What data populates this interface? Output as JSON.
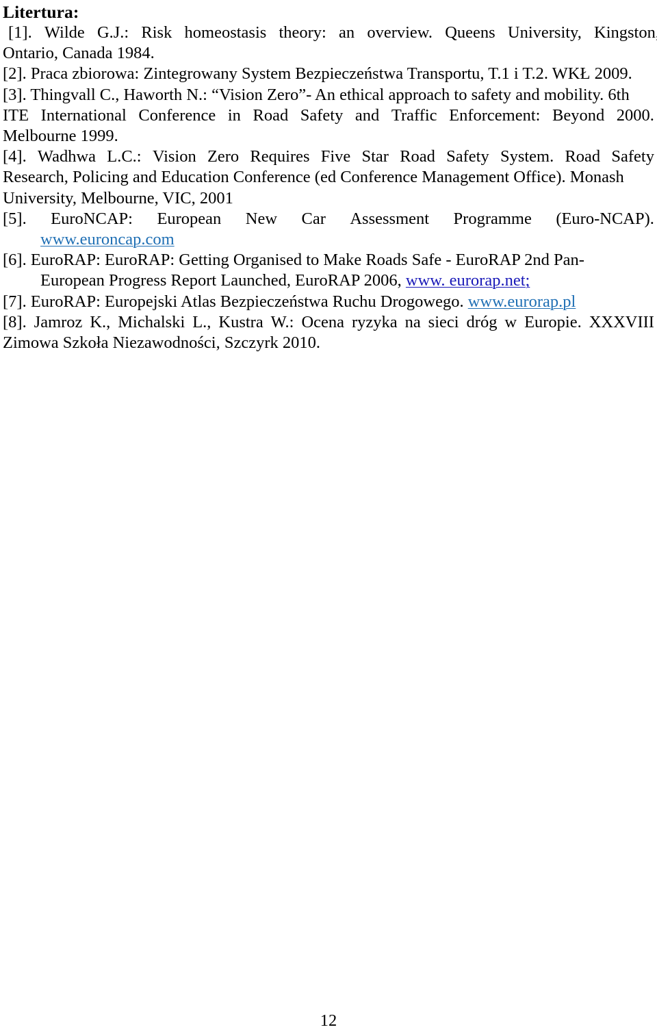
{
  "document": {
    "heading": "Litertura:",
    "page_number": "12",
    "link_color": "#1f6fb4",
    "link_color_alt": "#1818b8",
    "text_color": "#000000",
    "background_color": "#ffffff"
  },
  "references": [
    {
      "marker": "[1].",
      "lines": [
        {
          "segments": [
            {
              "text": "[1]."
            },
            {
              "text": "Wilde"
            },
            {
              "text": "G.J.:"
            },
            {
              "text": "Risk"
            },
            {
              "text": "homeostasis"
            },
            {
              "text": "theory:"
            },
            {
              "text": "an"
            },
            {
              "text": "overview."
            },
            {
              "text": "Queens"
            },
            {
              "text": "University,"
            },
            {
              "text": "Kingston,"
            }
          ],
          "justified": true,
          "indent": "first"
        },
        {
          "text": "Ontario, Canada 1984.",
          "justified": false
        }
      ]
    },
    {
      "marker": "[2].",
      "lines": [
        {
          "text": "[2]. Praca zbiorowa: Zintegrowany System Bezpieczeństwa Transportu, T.1 i T.2. WKŁ 2009.",
          "justified": false
        }
      ]
    },
    {
      "marker": "[3].",
      "lines": [
        {
          "text": "[3]. Thingvall C., Haworth N.: “Vision Zero”- An ethical approach to safety and mobility. 6th",
          "justified": false
        },
        {
          "segments": [
            {
              "text": "ITE"
            },
            {
              "text": "International"
            },
            {
              "text": "Conference"
            },
            {
              "text": "in"
            },
            {
              "text": "Road"
            },
            {
              "text": "Safety"
            },
            {
              "text": "and"
            },
            {
              "text": "Traffic"
            },
            {
              "text": "Enforcement:"
            },
            {
              "text": "Beyond"
            },
            {
              "text": "2000."
            }
          ],
          "justified": true
        },
        {
          "text": "Melbourne 1999.",
          "justified": false
        }
      ]
    },
    {
      "marker": "[4].",
      "lines": [
        {
          "segments": [
            {
              "text": "[4]."
            },
            {
              "text": "Wadhwa"
            },
            {
              "text": "L.C.:"
            },
            {
              "text": "Vision"
            },
            {
              "text": "Zero"
            },
            {
              "text": "Requires"
            },
            {
              "text": "Five"
            },
            {
              "text": "Star"
            },
            {
              "text": "Road"
            },
            {
              "text": "Safety"
            },
            {
              "text": "System."
            },
            {
              "text": "Road"
            },
            {
              "text": "Safety"
            }
          ],
          "justified": true
        },
        {
          "text": "Research, Policing and Education Conference (ed Conference Management Office). Monash",
          "justified": false
        },
        {
          "text": "University, Melbourne, VIC, 2001",
          "justified": false
        }
      ]
    },
    {
      "marker": "[5].",
      "lines": [
        {
          "segments": [
            {
              "text": "[5]."
            },
            {
              "text": "EuroNCAP:"
            },
            {
              "text": "European"
            },
            {
              "text": "New"
            },
            {
              "text": "Car"
            },
            {
              "text": "Assessment"
            },
            {
              "text": "Programme"
            },
            {
              "text": "(Euro-NCAP)."
            }
          ],
          "justified": true
        },
        {
          "text": "www.euroncap.com",
          "justified": false,
          "is_link": true,
          "link_style": "light",
          "indent": "hang"
        }
      ]
    },
    {
      "marker": "[6].",
      "lines": [
        {
          "text": "[6]. EuroRAP:  EuroRAP: Getting Organised to Make Roads Safe - EuroRAP 2nd Pan-",
          "justified": false
        },
        {
          "text": "European Progress Report Launched, EuroRAP 2006, ",
          "link_text": " www. eurorap.net;",
          "justified": false,
          "link_style": "navy",
          "indent": "hang"
        }
      ]
    },
    {
      "marker": "[7].",
      "lines": [
        {
          "text": "[7]. EuroRAP: Europejski Atlas Bezpieczeństwa Ruchu Drogowego. ",
          "link_text": "www.eurorap.pl",
          "justified": false,
          "link_style": "light"
        }
      ]
    },
    {
      "marker": "[8].",
      "lines": [
        {
          "segments": [
            {
              "text": "[8]."
            },
            {
              "text": "Jamroz"
            },
            {
              "text": "K.,"
            },
            {
              "text": "Michalski"
            },
            {
              "text": "L.,"
            },
            {
              "text": "Kustra"
            },
            {
              "text": "W.:"
            },
            {
              "text": "Ocena"
            },
            {
              "text": "ryzyka"
            },
            {
              "text": "na"
            },
            {
              "text": "sieci"
            },
            {
              "text": "dróg"
            },
            {
              "text": "w"
            },
            {
              "text": "Europie."
            },
            {
              "text": "XXXVIII"
            }
          ],
          "justified": true
        },
        {
          "text": "Zimowa Szkoła Niezawodności, Szczyrk 2010.",
          "justified": false
        }
      ]
    }
  ]
}
